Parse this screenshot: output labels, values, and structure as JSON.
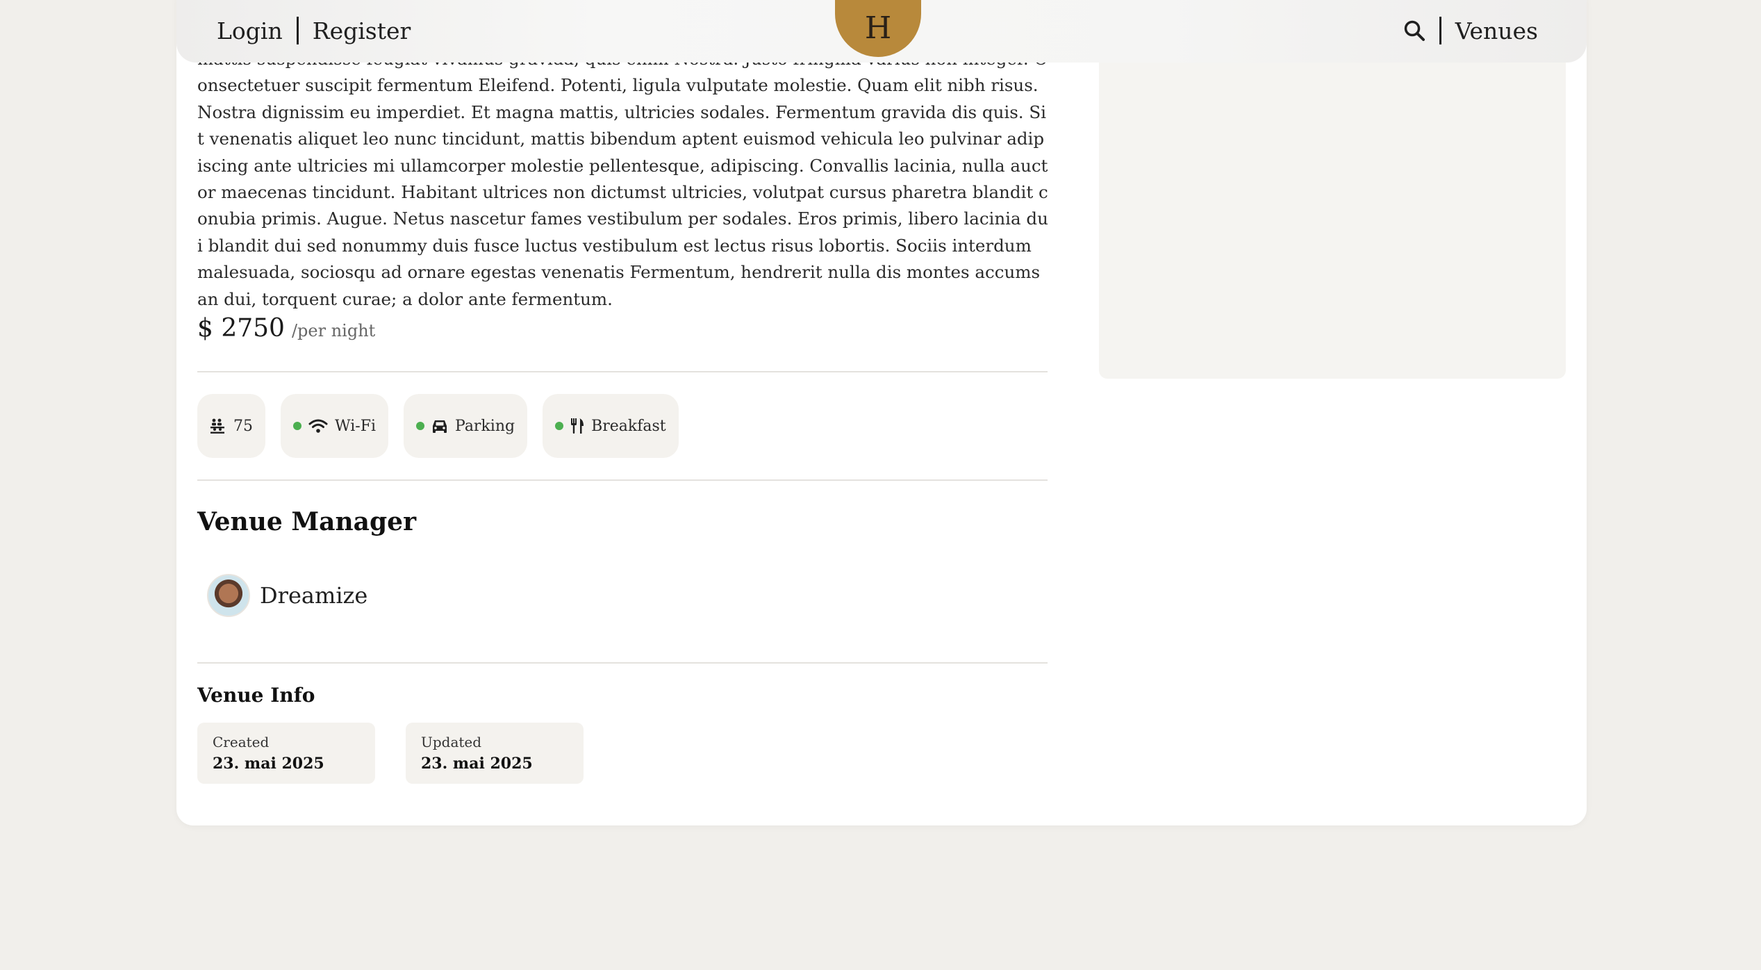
{
  "header": {
    "login": "Login",
    "register": "Register",
    "logo_letter": "H",
    "venues": "Venues",
    "search_icon": "search-icon"
  },
  "venue": {
    "description": "mattis suspendisse feugiat vivamus gravida, quis enim Nostra. Justo fringilla varius non integer. Consectetuer suscipit fermentum Eleifend. Potenti, ligula vulputate molestie. Quam elit nibh risus. Nostra dignissim eu imperdiet. Et magna mattis, ultricies sodales. Fermentum gravida dis quis. Sit venenatis aliquet leo nunc tincidunt, mattis bibendum aptent euismod vehicula leo pulvinar adipiscing ante ultricies mi ullamcorper molestie pellentesque, adipiscing. Convallis lacinia, nulla auctor maecenas tincidunt. Habitant ultrices non dictumst ultricies, volutpat cursus pharetra blandit conubia primis. Augue. Netus nascetur fames vestibulum per sodales. Eros primis, libero lacinia dui blandit dui sed nonummy duis fusce luctus vestibulum est lectus risus lobortis. Sociis interdum malesuada, sociosqu ad ornare egestas venenatis Fermentum, hendrerit nulla dis montes accumsan dui, torquent curae; a dolor ante fermentum.",
    "price": "$ 2750",
    "per_night": "/per night"
  },
  "amenities": {
    "guests": {
      "value": "75",
      "icon": "guests-icon"
    },
    "wifi": {
      "label": "Wi-Fi",
      "icon": "wifi-icon",
      "available": true
    },
    "parking": {
      "label": "Parking",
      "icon": "car-icon",
      "available": true
    },
    "breakfast": {
      "label": "Breakfast",
      "icon": "utensils-icon",
      "available": true
    }
  },
  "manager": {
    "section_title": "Venue Manager",
    "name": "Dreamize"
  },
  "venue_info": {
    "section_title": "Venue Info",
    "created_label": "Created",
    "created_value": "23. mai 2025",
    "updated_label": "Updated",
    "updated_value": "23. mai 2025"
  },
  "colors": {
    "accent": "#b8893b",
    "available_dot": "#4caf50",
    "background": "#f1efeb"
  }
}
